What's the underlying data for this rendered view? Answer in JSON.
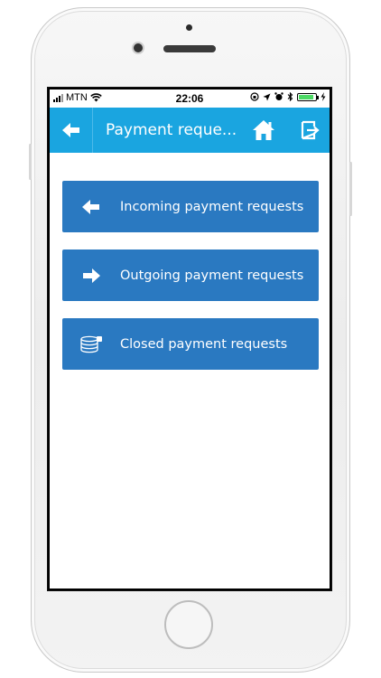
{
  "status_bar": {
    "carrier": "MTN",
    "time": "22:06"
  },
  "app_bar": {
    "title": "Payment reque...",
    "back_icon": "arrow-left-icon",
    "home_icon": "home-icon",
    "logout_icon": "exit-icon"
  },
  "menu": {
    "items": [
      {
        "label": "Incoming payment requests",
        "icon": "arrow-left-icon"
      },
      {
        "label": "Outgoing payment requests",
        "icon": "arrow-right-icon"
      },
      {
        "label": "Closed payment requests",
        "icon": "database-icon"
      }
    ]
  },
  "colors": {
    "app_bar": "#1aa5e0",
    "menu_button": "#2a79c1",
    "battery": "#4cd964"
  }
}
